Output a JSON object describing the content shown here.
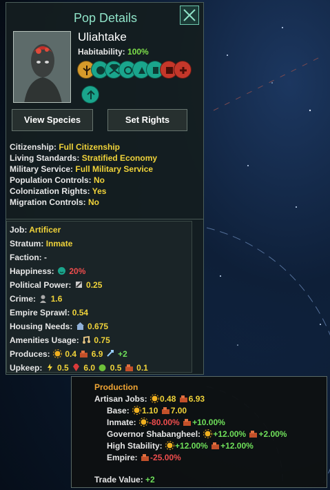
{
  "colors": {
    "accent": "#8fe3c8",
    "yellow": "#f0d33a",
    "green": "#6fe05a",
    "red": "#ef4d4d",
    "orange": "#f0a534"
  },
  "panel": {
    "title": "Pop Details",
    "close_icon": "close-icon",
    "pop_name": "Uliahtake",
    "habitability_label": "Habitability:",
    "habitability_value": "100%",
    "traits": [
      "bio-trait-icon",
      "trait-icon",
      "trait-icon",
      "trait-icon",
      "trait-icon",
      "trait-icon",
      "trait-icon",
      "trait-icon"
    ],
    "buttons": {
      "view_species": "View Species",
      "set_rights": "Set Rights"
    }
  },
  "rights": [
    {
      "label": "Citizenship:",
      "value": "Full Citizenship"
    },
    {
      "label": "Living Standards:",
      "value": "Stratified Economy"
    },
    {
      "label": "Military Service:",
      "value": "Full Military Service"
    },
    {
      "label": "Population Controls:",
      "value": "No"
    },
    {
      "label": "Colonization Rights:",
      "value": "Yes"
    },
    {
      "label": "Migration Controls:",
      "value": "No"
    }
  ],
  "stats": {
    "job_label": "Job:",
    "job": "Artificer",
    "stratum_label": "Stratum:",
    "stratum": "Inmate",
    "faction_label": "Faction:",
    "faction": "-",
    "happiness_label": "Happiness:",
    "happiness": "20%",
    "political_label": "Political Power:",
    "political": "0.25",
    "crime_label": "Crime:",
    "crime": "1.6",
    "sprawl_label": "Empire Sprawl:",
    "sprawl": "0.54",
    "housing_label": "Housing Needs:",
    "housing": "0.675",
    "amenities_label": "Amenities Usage:",
    "amenities": "0.75",
    "produces_label": "Produces:",
    "produces_unity": "0.4",
    "produces_goods": "6.9",
    "produces_trade": "+2",
    "upkeep_label": "Upkeep:",
    "upkeep_energy": "0.5",
    "upkeep_gems": "6.0",
    "upkeep_food": "0.5",
    "upkeep_goods": "0.1"
  },
  "tooltip": {
    "header": "Production",
    "artisan_label": "Artisan Jobs:",
    "artisan_unity": "0.48",
    "artisan_goods": "6.93",
    "base_label": "Base:",
    "base_unity": "1.10",
    "base_goods": "7.00",
    "inmate_label": "Inmate:",
    "inmate_unity": "-80.00%",
    "inmate_goods": "+10.00%",
    "governor_label": "Governor Shabangheel:",
    "governor_unity": "+12.00%",
    "governor_goods": "+2.00%",
    "stability_label": "High Stability:",
    "stability_unity": "+12.00%",
    "stability_goods": "+12.00%",
    "empire_label": "Empire:",
    "empire_goods": "-25.00%",
    "trade_label": "Trade Value:",
    "trade_value": "+2"
  }
}
